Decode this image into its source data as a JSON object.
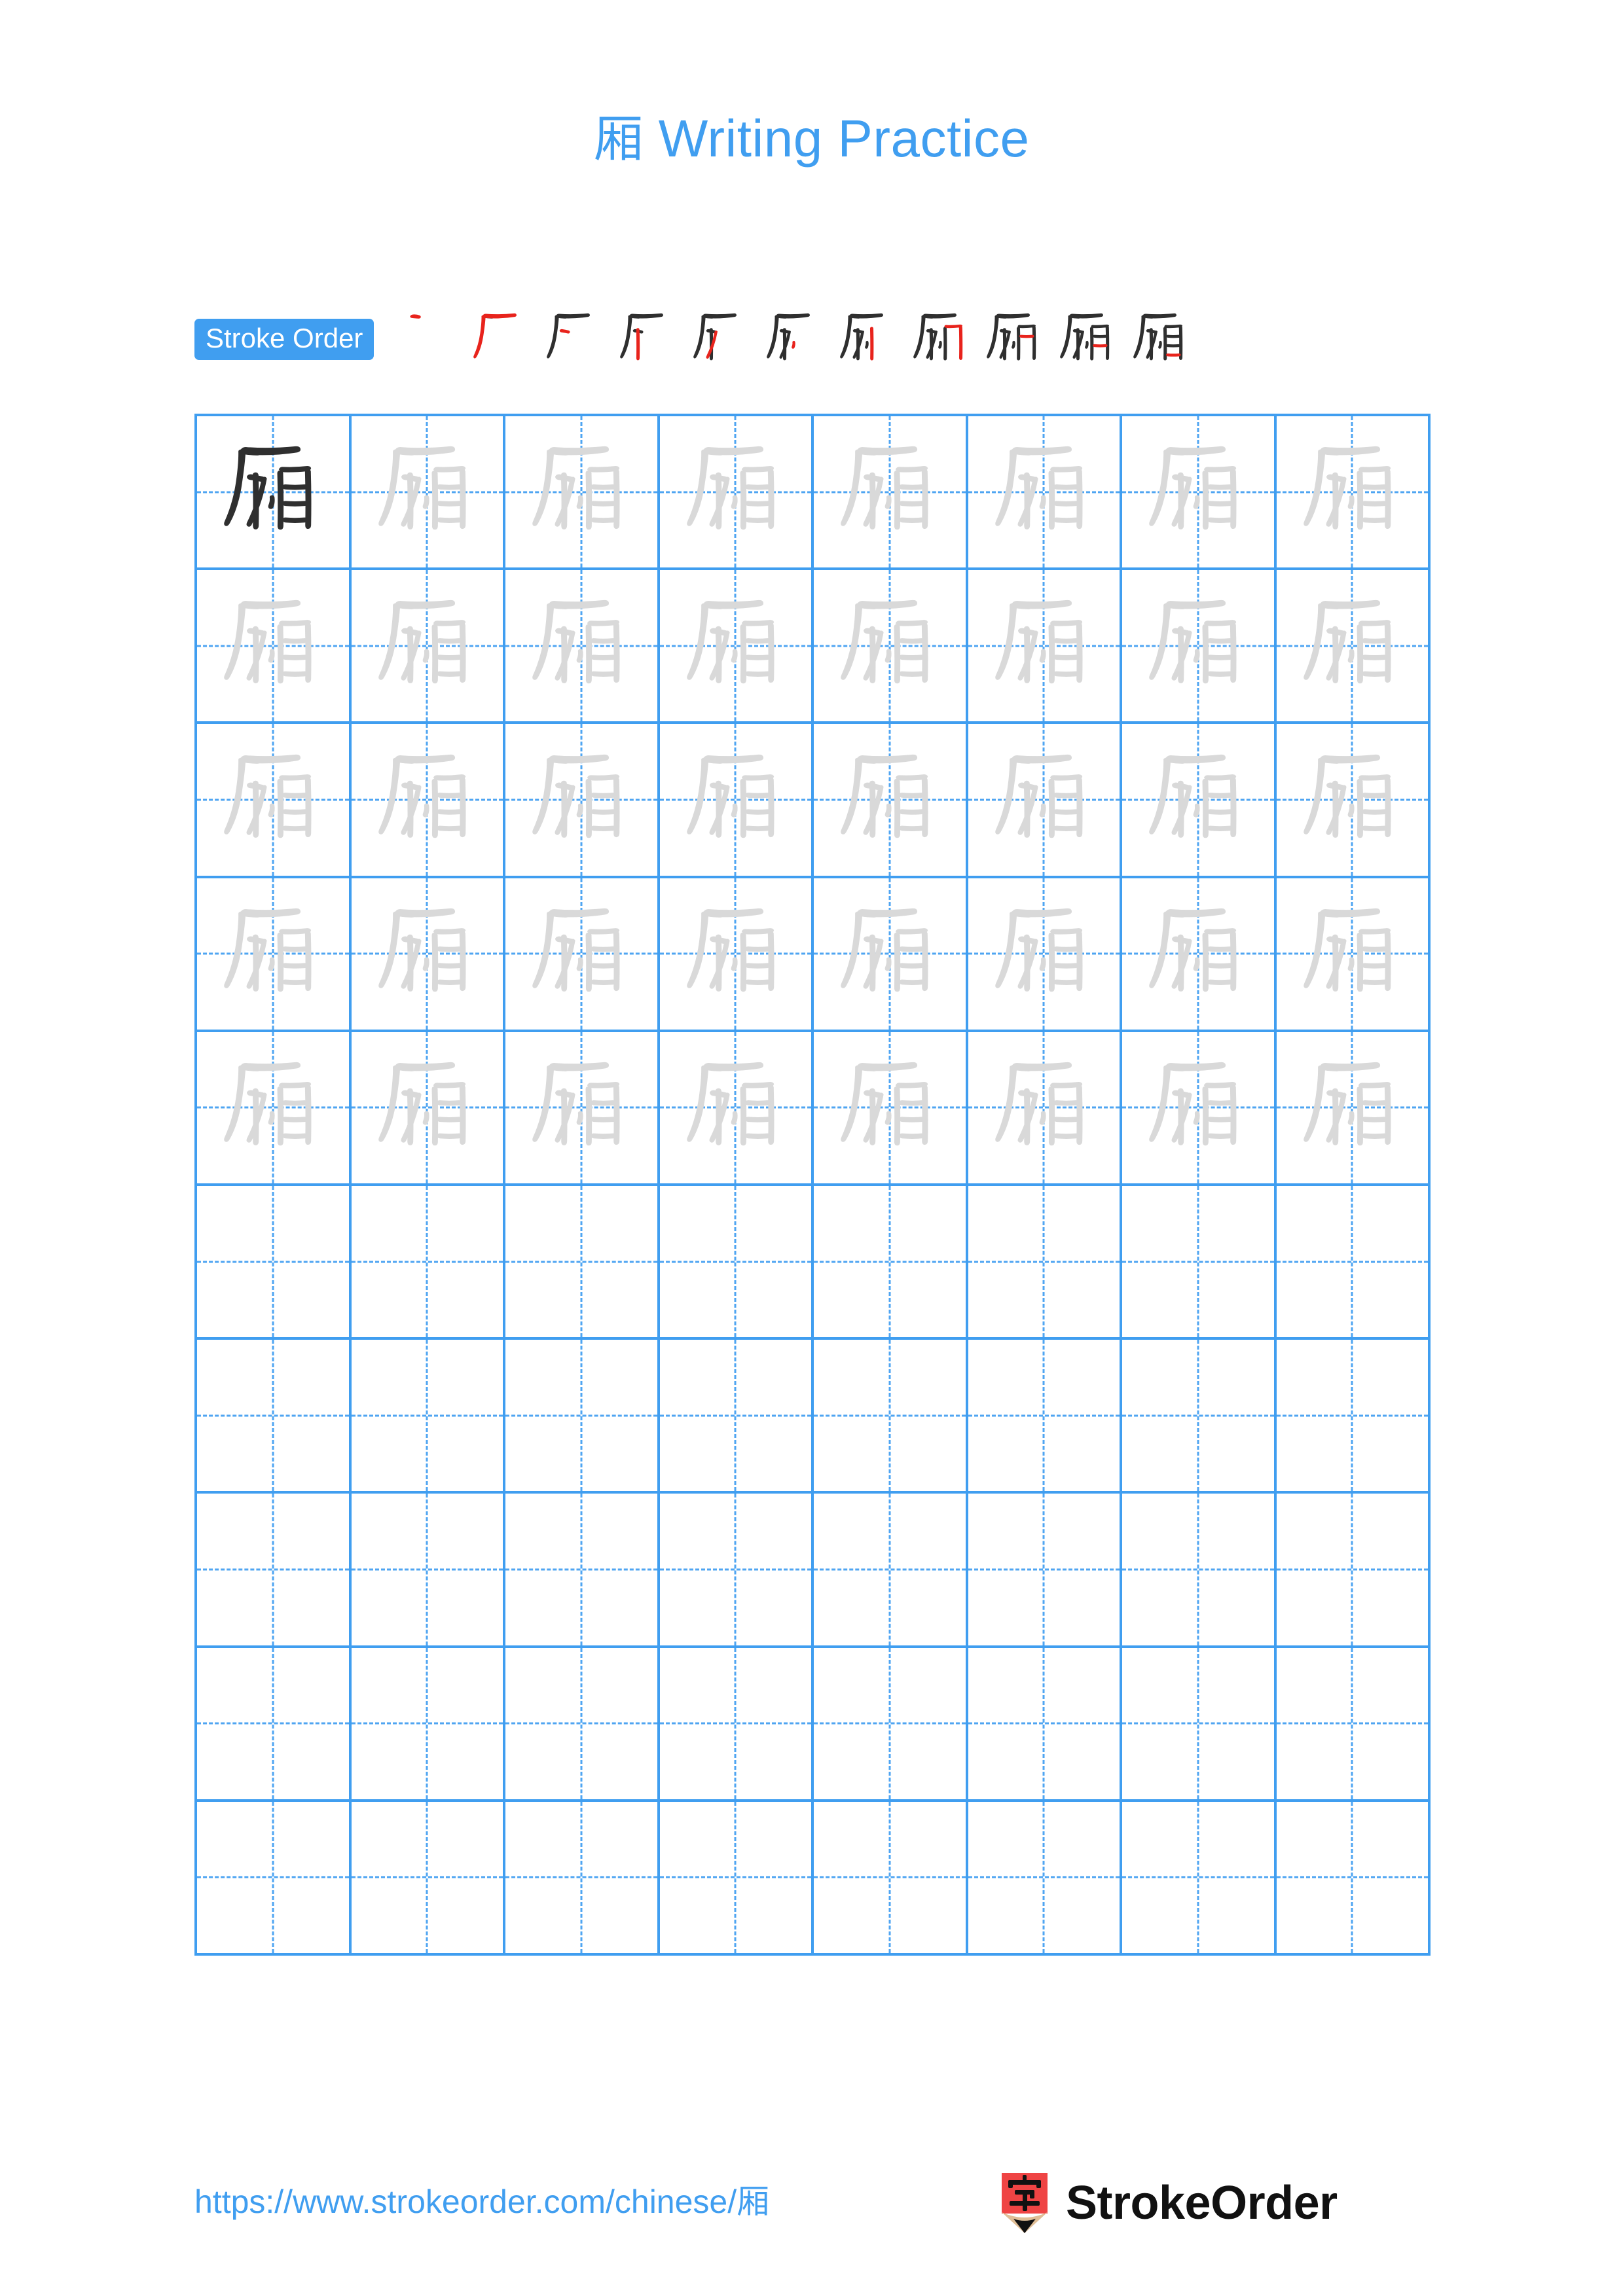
{
  "page": {
    "character": "厢",
    "background_color": "#ffffff",
    "accent_blue": "#409EF0",
    "grid_line_color": "#409EF0",
    "guide_line_color": "#4FA5F2",
    "trace_gray": "#D9D9D9",
    "ink_dark": "#2F2F2F",
    "new_stroke_red": "#E8231C"
  },
  "title": {
    "character": "厢",
    "text": " Writing Practice",
    "full": "厢 Writing Practice",
    "color": "#409EF0"
  },
  "stroke_order": {
    "badge_label": "Stroke Order",
    "badge_bg": "#409EF0",
    "badge_text_color": "#ffffff",
    "total_strokes": 11,
    "steps": [
      {
        "index": 1,
        "strokes_shown": 1,
        "new_stroke_index": 1
      },
      {
        "index": 2,
        "strokes_shown": 2,
        "new_stroke_index": 2
      },
      {
        "index": 3,
        "strokes_shown": 3,
        "new_stroke_index": 3
      },
      {
        "index": 4,
        "strokes_shown": 4,
        "new_stroke_index": 4
      },
      {
        "index": 5,
        "strokes_shown": 5,
        "new_stroke_index": 5
      },
      {
        "index": 6,
        "strokes_shown": 6,
        "new_stroke_index": 6
      },
      {
        "index": 7,
        "strokes_shown": 7,
        "new_stroke_index": 7
      },
      {
        "index": 8,
        "strokes_shown": 8,
        "new_stroke_index": 8
      },
      {
        "index": 9,
        "strokes_shown": 9,
        "new_stroke_index": 9
      },
      {
        "index": 10,
        "strokes_shown": 10,
        "new_stroke_index": 10
      },
      {
        "index": 11,
        "strokes_shown": 11,
        "new_stroke_index": 11
      }
    ]
  },
  "practice_grid": {
    "columns": 8,
    "rows": 10,
    "filled_rows": 5,
    "empty_rows": 5,
    "first_cell_style": "dark",
    "trace_cell_style": "light",
    "guide_lines": "dashed-cross"
  },
  "footer": {
    "url_prefix": "https://www.strokeorder.com/chinese/",
    "url_character": "厢",
    "url_full": "https://www.strokeorder.com/chinese/厢",
    "brand_name": "StrokeOrder",
    "logo_character": "字",
    "logo_body_color": "#EF4444",
    "logo_wood_color": "#E0BE96",
    "logo_tip_color": "#111111"
  }
}
